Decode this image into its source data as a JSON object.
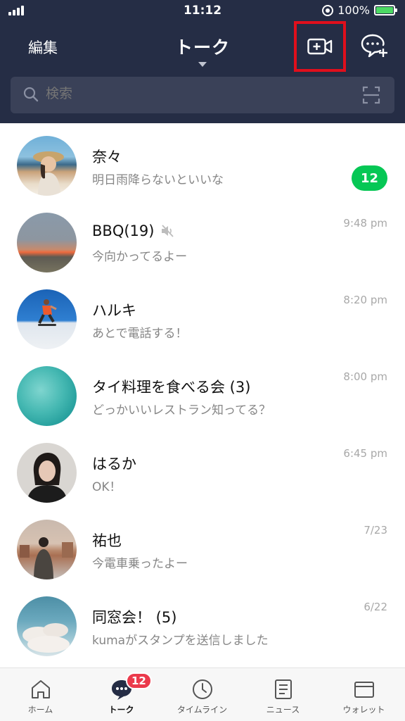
{
  "status_bar": {
    "time": "11:12",
    "battery": "100%"
  },
  "header": {
    "edit_label": "編集",
    "title": "トーク"
  },
  "search": {
    "placeholder": "検索"
  },
  "chats": [
    {
      "name": "奈々",
      "preview": "明日雨降らないといいな",
      "time": "",
      "unread": "12",
      "muted": false
    },
    {
      "name": "BBQ(19)",
      "preview": "今向かってるよー",
      "time": "9:48 pm",
      "unread": "",
      "muted": true
    },
    {
      "name": "ハルキ",
      "preview": "あとで電話する！",
      "time": "8:20 pm",
      "unread": "",
      "muted": false
    },
    {
      "name": "タイ料理を食べる会 (3)",
      "preview": "どっかいいレストラン知ってる？",
      "time": "8:00 pm",
      "unread": "",
      "muted": false
    },
    {
      "name": "はるか",
      "preview": "OK！",
      "time": "6:45 pm",
      "unread": "",
      "muted": false
    },
    {
      "name": "祐也",
      "preview": "今電車乗ったよー",
      "time": "7/23",
      "unread": "",
      "muted": false
    },
    {
      "name": "同窓会！ (5)",
      "preview": "kumaがスタンプを送信しました",
      "time": "6/22",
      "unread": "",
      "muted": false
    }
  ],
  "tabs": [
    {
      "label": "ホーム",
      "icon": "home-icon"
    },
    {
      "label": "トーク",
      "icon": "chat-icon",
      "badge": "12",
      "active": true
    },
    {
      "label": "タイムライン",
      "icon": "clock-icon"
    },
    {
      "label": "ニュース",
      "icon": "news-icon"
    },
    {
      "label": "ウォレット",
      "icon": "wallet-icon"
    }
  ],
  "colors": {
    "header_bg": "#252d45",
    "unread_badge": "#06c755",
    "tab_badge": "#eb3a4c",
    "highlight_box": "#e00f1c"
  }
}
